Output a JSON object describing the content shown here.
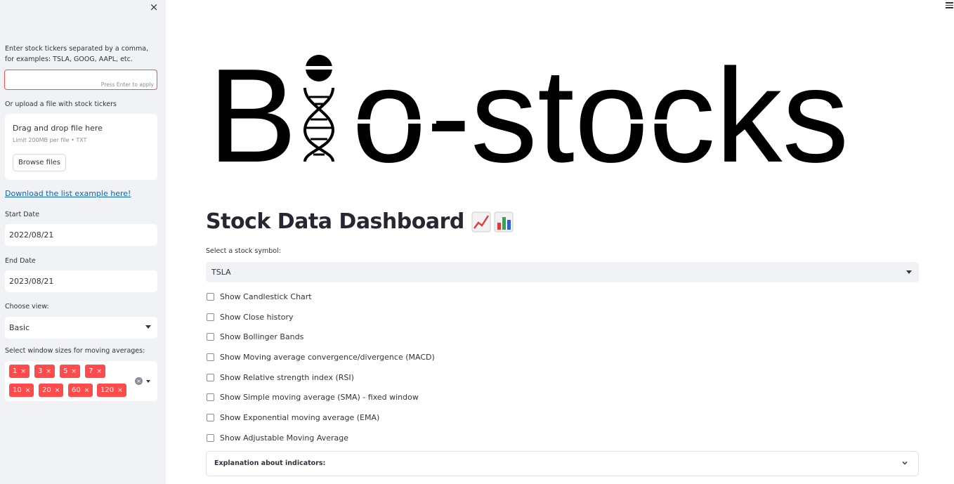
{
  "sidebar": {
    "close_icon": "close-icon",
    "ticker_label": "Enter stock tickers separated by a comma, for examples: TSLA, GOOG, AAPL, etc.",
    "ticker_value": "",
    "ticker_hint": "Press Enter to apply",
    "upload_label": "Or upload a file with stock tickers",
    "upload": {
      "title": "Drag and drop file here",
      "subtitle": "Limit 200MB per file • TXT",
      "button": "Browse files"
    },
    "download_link": "Download the list example here!",
    "start_date_label": "Start Date",
    "start_date": "2022/08/21",
    "end_date_label": "End Date",
    "end_date": "2023/08/21",
    "view_label": "Choose view:",
    "view_value": "Basic",
    "windows_label": "Select window sizes for moving averages:",
    "windows": [
      "1",
      "3",
      "5",
      "7",
      "10",
      "20",
      "60",
      "120"
    ],
    "tag_remove": "×",
    "clear_all": "×"
  },
  "main": {
    "menu_icon": "hamburger-menu-icon",
    "logo_text": "Bio-stocks",
    "title": "Stock Data Dashboard",
    "title_icons": [
      "chart-increasing-icon",
      "bar-chart-icon"
    ],
    "symbol_label": "Select a stock symbol:",
    "symbol_value": "TSLA",
    "options": [
      "Show Candlestick Chart",
      "Show Close history",
      "Show Bollinger Bands",
      "Show Moving average convergence/divergence (MACD)",
      "Show Relative strength index (RSI)",
      "Show Simple moving average (SMA) - fixed window",
      "Show Exponential moving average (EMA)",
      "Show Adjustable Moving Average"
    ],
    "expander_title": "Explanation about indicators:"
  },
  "colors": {
    "accent": "#ff4b4b",
    "sidebar_bg": "#f0f2f6",
    "text": "#31333f",
    "link": "#0b63c5"
  }
}
